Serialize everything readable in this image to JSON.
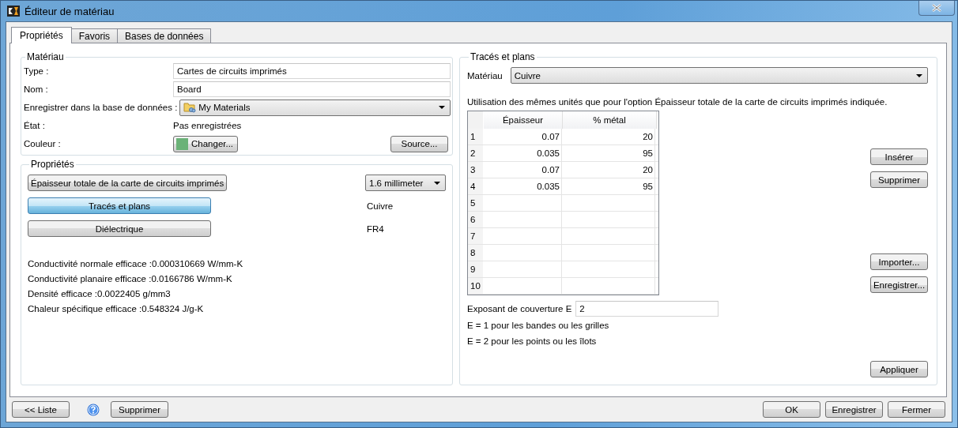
{
  "window": {
    "title": "Éditeur de matériau"
  },
  "tabs": [
    {
      "label": "Propriétés",
      "selected": true
    },
    {
      "label": "Favoris",
      "selected": false
    },
    {
      "label": "Bases de données",
      "selected": false
    }
  ],
  "material": {
    "title": "Matériau",
    "type": {
      "label": "Type :",
      "value": "Cartes de circuits imprimés"
    },
    "name": {
      "label": "Nom :",
      "value": "Board"
    },
    "database": {
      "label": "Enregistrer dans la base de données :",
      "value": "My Materials"
    },
    "state": {
      "label": "État :",
      "value": "Pas enregistrées"
    },
    "color": {
      "label": "Couleur :",
      "color": "#6bb278",
      "button": "Changer...",
      "source_button": "Source..."
    }
  },
  "properties": {
    "title": "Propriétés",
    "buttons": [
      {
        "label": "Épaisseur totale de la carte de circuits imprimés",
        "selected": false,
        "kind": "dropdown",
        "value": "1.6 millimeter"
      },
      {
        "label": "Tracés et plans",
        "selected": true,
        "kind": "text",
        "value": "Cuivre"
      },
      {
        "label": "Diélectrique",
        "selected": false,
        "kind": "text",
        "value": "FR4"
      }
    ],
    "results": [
      "Conductivité normale efficace :0.000310669 W/mm-K",
      "Conductivité planaire efficace :0.0166786 W/mm-K",
      "Densité efficace :0.0022405 g/mm3",
      "Chaleur spécifique efficace :0.548324 J/g-K"
    ]
  },
  "traces": {
    "title": "Tracés et plans",
    "material": {
      "label": "Matériau",
      "value": "Cuivre"
    },
    "note": "Utilisation des mêmes unités que pour l'option Épaisseur totale de la carte de circuits imprimés indiquée.",
    "table": {
      "columns": [
        "Épaisseur",
        "% métal"
      ],
      "rows": [
        {
          "number": "1",
          "cells": [
            "0.07",
            "20"
          ]
        },
        {
          "number": "2",
          "cells": [
            "0.035",
            "95"
          ]
        },
        {
          "number": "3",
          "cells": [
            "0.07",
            "20"
          ]
        },
        {
          "number": "4",
          "cells": [
            "0.035",
            "95"
          ]
        },
        {
          "number": "5",
          "cells": []
        },
        {
          "number": "6",
          "cells": []
        },
        {
          "number": "7",
          "cells": []
        },
        {
          "number": "8",
          "cells": []
        },
        {
          "number": "9",
          "cells": []
        },
        {
          "number": "10",
          "cells": []
        }
      ]
    },
    "top_buttons": [
      "Insérer",
      "Supprimer"
    ],
    "file_buttons": [
      "Importer...",
      "Enregistrer..."
    ],
    "exponent": {
      "label": "Exposant de couverture E",
      "value": "2"
    },
    "hints": [
      "E = 1 pour les bandes ou les grilles",
      "E = 2 pour les points ou les îlots"
    ],
    "apply_button": "Appliquer"
  },
  "footer": {
    "left_buttons": [
      "<< Liste",
      "Supprimer"
    ],
    "right_buttons": [
      "OK",
      "Enregistrer",
      "Fermer"
    ]
  }
}
